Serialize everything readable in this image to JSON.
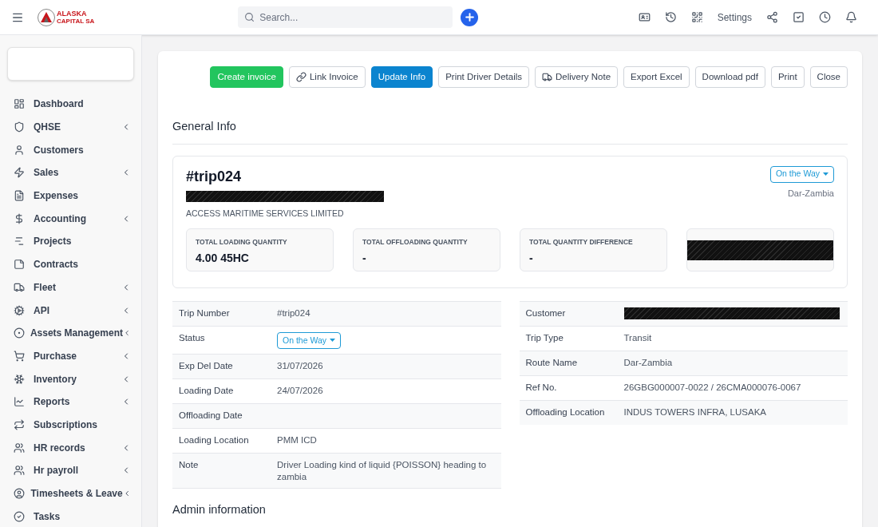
{
  "header": {
    "logo_text": "ALASKA",
    "logo_subtext": "CAPITAL SA",
    "search": {
      "placeholder": "Search..."
    },
    "settings_label": "Settings"
  },
  "sidebar": {
    "items": [
      {
        "label": "Dashboard",
        "kind": "dashboard",
        "expandable": false
      },
      {
        "label": "QHSE",
        "kind": "shield",
        "expandable": true
      },
      {
        "label": "Customers",
        "kind": "user",
        "expandable": false
      },
      {
        "label": "Sales",
        "kind": "bolt",
        "expandable": true
      },
      {
        "label": "Expenses",
        "kind": "file",
        "expandable": false
      },
      {
        "label": "Accounting",
        "kind": "dollar",
        "expandable": true
      },
      {
        "label": "Projects",
        "kind": "projects",
        "expandable": false
      },
      {
        "label": "Contracts",
        "kind": "note",
        "expandable": false
      },
      {
        "label": "Fleet",
        "kind": "truck",
        "expandable": true
      },
      {
        "label": "API",
        "kind": "gears",
        "expandable": true
      },
      {
        "label": "Assets Management",
        "kind": "target",
        "expandable": true
      },
      {
        "label": "Purchase",
        "kind": "cart",
        "expandable": true
      },
      {
        "label": "Inventory",
        "kind": "snow",
        "expandable": true
      },
      {
        "label": "Reports",
        "kind": "chart",
        "expandable": true
      },
      {
        "label": "Subscriptions",
        "kind": "repeat",
        "expandable": false
      },
      {
        "label": "HR records",
        "kind": "users",
        "expandable": true
      },
      {
        "label": "Hr payroll",
        "kind": "users",
        "expandable": true
      },
      {
        "label": "Timesheets & Leave",
        "kind": "usercircle",
        "expandable": true
      },
      {
        "label": "Tasks",
        "kind": "check",
        "expandable": false
      }
    ]
  },
  "actions": [
    {
      "label": "Create invoice",
      "kind": "success"
    },
    {
      "label": "Link Invoice",
      "kind": "link"
    },
    {
      "label": "Update Info",
      "kind": "primary"
    },
    {
      "label": "Print Driver Details",
      "kind": "outline"
    },
    {
      "label": "Delivery Note",
      "kind": "delivery"
    },
    {
      "label": "Export Excel",
      "kind": "outline"
    },
    {
      "label": "Download pdf",
      "kind": "outline"
    },
    {
      "label": "Print",
      "kind": "outline"
    },
    {
      "label": "Close",
      "kind": "outline"
    }
  ],
  "section_title": "General Info",
  "trip": {
    "number": "#trip024",
    "company": "ACCESS MARITIME SERVICES LIMITED",
    "status": "On the Way",
    "route": "Dar-Zambia",
    "stats": [
      {
        "label": "TOTAL LOADING QUANTITY",
        "value": "4.00 45HC",
        "kind": "text"
      },
      {
        "label": "TOTAL OFFLOADING QUANTITY",
        "value": "-",
        "kind": "text"
      },
      {
        "label": "TOTAL QUANTITY DIFFERENCE",
        "value": "-",
        "kind": "text"
      },
      {
        "kind": "redacted"
      }
    ]
  },
  "details_left": [
    {
      "label": "Trip Number",
      "value": "#trip024",
      "kind": "text"
    },
    {
      "label": "Status",
      "value": "On the Way",
      "kind": "select"
    },
    {
      "label": "Exp Del Date",
      "value": "31/07/2026",
      "kind": "text"
    },
    {
      "label": "Loading Date",
      "value": "24/07/2026",
      "kind": "text"
    },
    {
      "label": "Offloading Date",
      "kind": "empty"
    },
    {
      "label": "Loading Location",
      "value": "PMM ICD",
      "kind": "text"
    },
    {
      "label": "Note",
      "value": "Driver Loading kind of liquid {POISSON} heading to zambia",
      "kind": "text"
    }
  ],
  "details_right": [
    {
      "label": "Customer",
      "kind": "redacted"
    },
    {
      "label": "Trip Type",
      "value": "Transit",
      "kind": "text"
    },
    {
      "label": "Route Name",
      "value": "Dar-Zambia",
      "kind": "text"
    },
    {
      "label": "Ref No.",
      "value": "26GBG000007-0022 / 26CMA000076-0067",
      "kind": "text"
    },
    {
      "label": "Offloading Location",
      "value": "INDUS TOWERS INFRA, LUSAKA",
      "kind": "text"
    }
  ],
  "admin_title": "Admin information"
}
